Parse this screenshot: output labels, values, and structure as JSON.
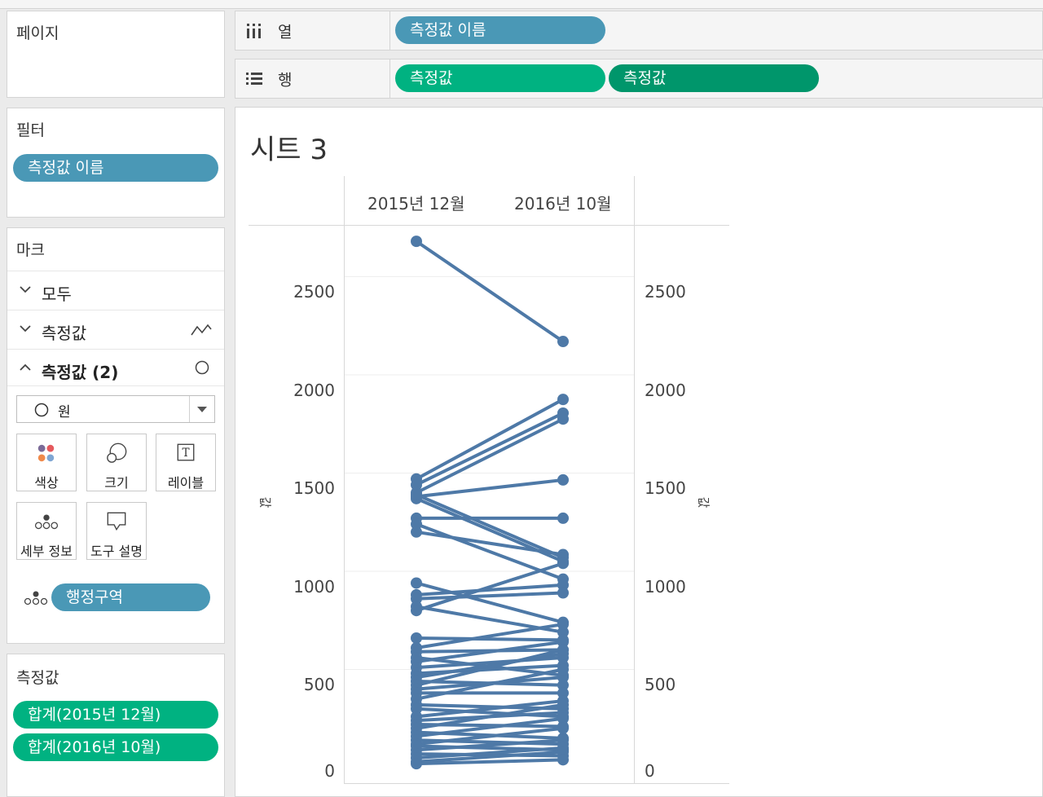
{
  "pages_card": {
    "title": "페이지"
  },
  "columns_shelf": {
    "label": "열",
    "pill": "측정값 이름"
  },
  "rows_shelf": {
    "label": "행",
    "pills": [
      "측정값",
      "측정값"
    ]
  },
  "filters_card": {
    "title": "필터",
    "pill": "측정값 이름"
  },
  "marks_card": {
    "title": "마크",
    "rows": [
      {
        "label": "모두",
        "chevron": "chevron-down"
      },
      {
        "label": "측정값",
        "chevron": "chevron-down",
        "mark_icon": "line-mark-icon"
      },
      {
        "label": "측정값 (2)",
        "chevron": "chevron-up",
        "mark_icon": "circle-mark-icon"
      }
    ],
    "mark_type": "원",
    "buttons": [
      "색상",
      "크기",
      "레이블",
      "세부 정보",
      "도구 설명"
    ],
    "detail_pill": "행정구역"
  },
  "measures_card": {
    "title": "측정값",
    "pills": [
      "합계(2015년 12월)",
      "합계(2016년 10월)"
    ]
  },
  "sheet": {
    "title": "시트 3"
  },
  "chart_data": {
    "type": "line",
    "categories": [
      "2015년 12월",
      "2016년 10월"
    ],
    "ylabel": "값",
    "ylabel_right": "값",
    "ylim": [
      0,
      2800
    ],
    "yticks": [
      "0",
      "500",
      "1000",
      "1500",
      "2000",
      "2500"
    ],
    "y_axis_dual": true,
    "grid": "horizontal",
    "color": "#4e79a7",
    "pairs": [
      [
        2680,
        2170
      ],
      [
        1470,
        1875
      ],
      [
        1440,
        1805
      ],
      [
        1400,
        1775
      ],
      [
        1380,
        1465
      ],
      [
        1370,
        1050
      ],
      [
        1270,
        1270
      ],
      [
        1240,
        960
      ],
      [
        1200,
        1085
      ],
      [
        1390,
        1070
      ],
      [
        940,
        740
      ],
      [
        880,
        930
      ],
      [
        860,
        890
      ],
      [
        820,
        690
      ],
      [
        800,
        1040
      ],
      [
        660,
        650
      ],
      [
        610,
        730
      ],
      [
        590,
        600
      ],
      [
        560,
        470
      ],
      [
        540,
        640
      ],
      [
        510,
        560
      ],
      [
        480,
        520
      ],
      [
        460,
        580
      ],
      [
        440,
        420
      ],
      [
        420,
        600
      ],
      [
        400,
        460
      ],
      [
        380,
        380
      ],
      [
        350,
        500
      ],
      [
        320,
        300
      ],
      [
        300,
        260
      ],
      [
        260,
        340
      ],
      [
        240,
        280
      ],
      [
        220,
        210
      ],
      [
        200,
        320
      ],
      [
        180,
        150
      ],
      [
        160,
        250
      ],
      [
        140,
        120
      ],
      [
        120,
        200
      ],
      [
        110,
        90
      ],
      [
        90,
        140
      ],
      [
        70,
        60
      ],
      [
        50,
        100
      ],
      [
        30,
        80
      ],
      [
        20,
        40
      ]
    ]
  }
}
